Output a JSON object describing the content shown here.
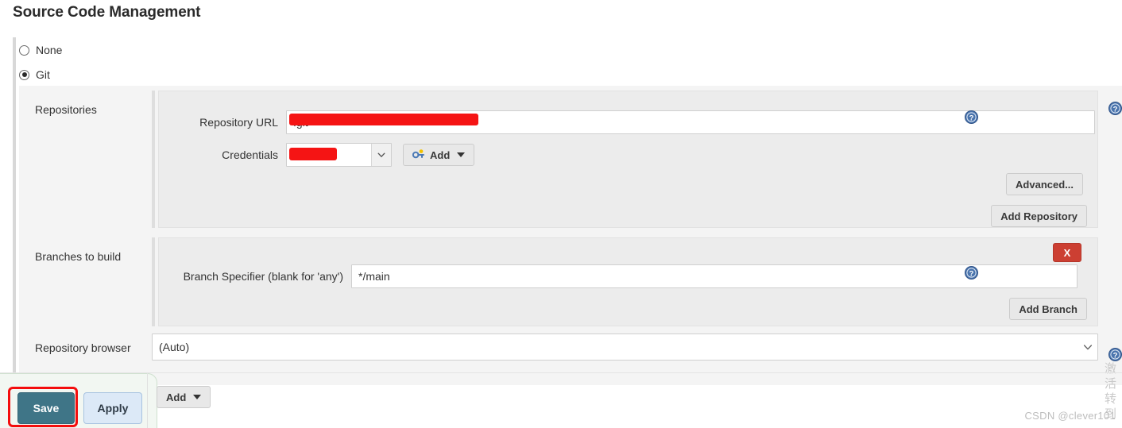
{
  "page": {
    "title": "Source Code Management"
  },
  "scm": {
    "options": [
      {
        "label": "None",
        "selected": false
      },
      {
        "label": "Git",
        "selected": true
      }
    ]
  },
  "repositories": {
    "section_label": "Repositories",
    "repository_url": {
      "label": "Repository URL",
      "value": ".git",
      "redacted": true
    },
    "credentials": {
      "label": "Credentials",
      "value": "/******",
      "redacted": true
    },
    "add_credentials_button": "Add",
    "advanced_button": "Advanced...",
    "add_repository_button": "Add Repository"
  },
  "branches": {
    "section_label": "Branches to build",
    "branch_specifier": {
      "label": "Branch Specifier (blank for 'any')",
      "value": "*/main"
    },
    "delete_button": "X",
    "add_branch_button": "Add Branch"
  },
  "repository_browser": {
    "label": "Repository browser",
    "value": "(Auto)"
  },
  "footer": {
    "save_button": "Save",
    "apply_button": "Apply",
    "add_button": "Add"
  },
  "watermarks": {
    "csdn": "CSDN @clever101",
    "windows_line1": "激活",
    "windows_line2": "转到"
  },
  "icons": {
    "help": "help-icon",
    "key": "key-icon",
    "chevron": "chevron-down-icon"
  },
  "colors": {
    "save": "#3f7587",
    "apply": "#dce9f7",
    "delete": "#cc3f32",
    "redaction": "#f51414",
    "help": "#3b6ea5"
  }
}
